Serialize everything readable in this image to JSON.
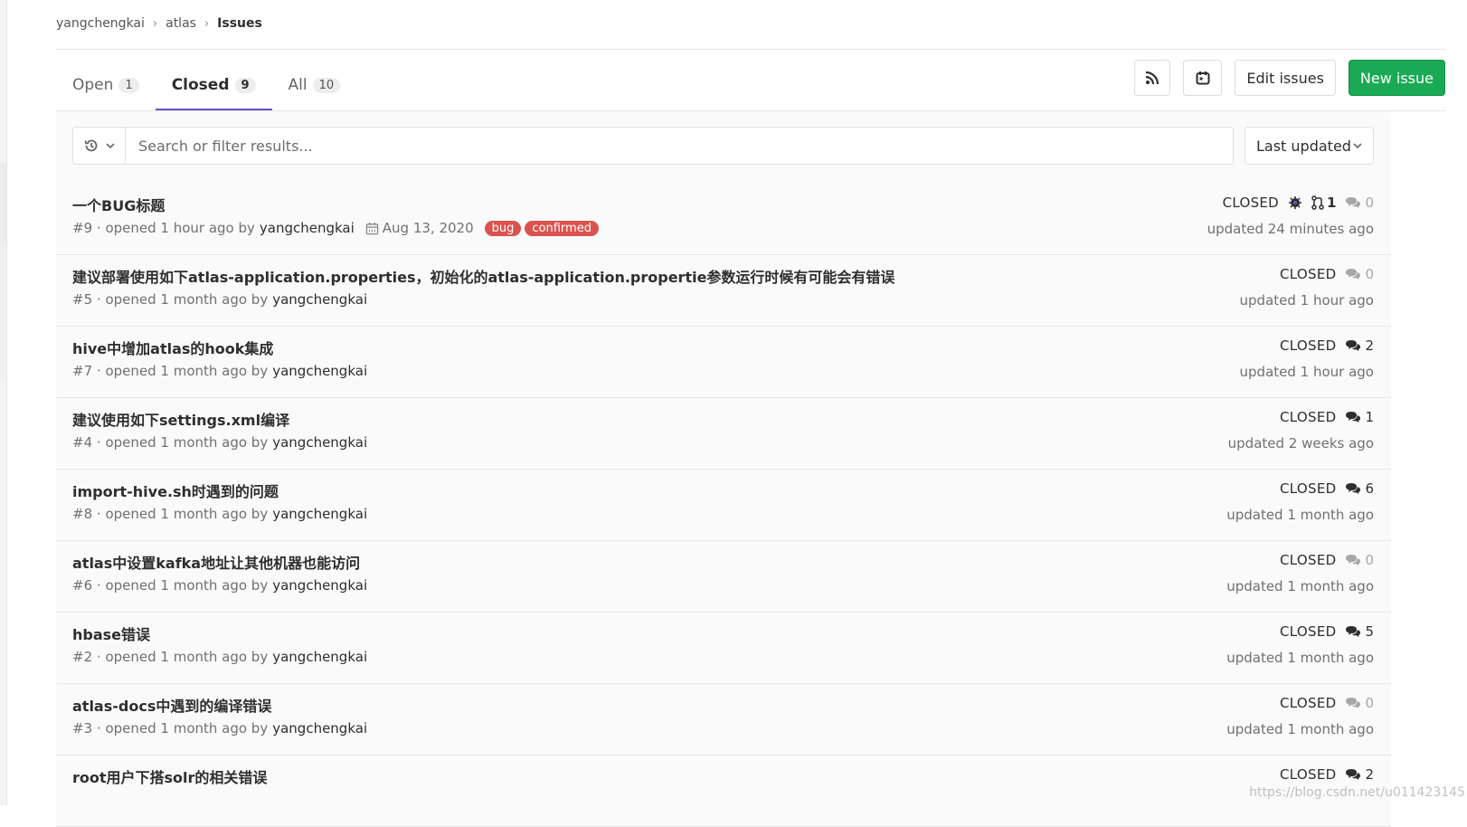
{
  "breadcrumb": {
    "items": [
      "yangchengkai",
      "atlas"
    ],
    "current": "Issues"
  },
  "tabs": [
    {
      "label": "Open",
      "count": "1",
      "active": false
    },
    {
      "label": "Closed",
      "count": "9",
      "active": true
    },
    {
      "label": "All",
      "count": "10",
      "active": false
    }
  ],
  "actions": {
    "rss_icon": "rss-icon",
    "calendar_icon": "calendar-icon",
    "edit_label": "Edit issues",
    "new_label": "New issue"
  },
  "filter": {
    "placeholder": "Search or filter results...",
    "sort_label": "Last updated"
  },
  "colors": {
    "accent": "#6b4fbb",
    "primary": "#1aaa55",
    "label_bg": "#d9534f"
  },
  "issues": [
    {
      "title": "一个BUG标题",
      "number": "#9",
      "opened": "opened 1 hour ago by",
      "author": "yangchengkai",
      "due": "Aug 13, 2020",
      "labels": [
        "bug",
        "confirmed"
      ],
      "state": "CLOSED",
      "milestone": true,
      "mr_count": "1",
      "notes": "0",
      "updated": "updated 24 minutes ago"
    },
    {
      "title": "建议部署使用如下atlas-application.properties，初始化的atlas-application.propertie参数运行时候有可能会有错误",
      "number": "#5",
      "opened": "opened 1 month ago by",
      "author": "yangchengkai",
      "state": "CLOSED",
      "notes": "0",
      "updated": "updated 1 hour ago"
    },
    {
      "title": "hive中增加atlas的hook集成",
      "number": "#7",
      "opened": "opened 1 month ago by",
      "author": "yangchengkai",
      "state": "CLOSED",
      "notes": "2",
      "updated": "updated 1 hour ago"
    },
    {
      "title": "建议使用如下settings.xml编译",
      "number": "#4",
      "opened": "opened 1 month ago by",
      "author": "yangchengkai",
      "state": "CLOSED",
      "notes": "1",
      "updated": "updated 2 weeks ago"
    },
    {
      "title": "import-hive.sh时遇到的问题",
      "number": "#8",
      "opened": "opened 1 month ago by",
      "author": "yangchengkai",
      "state": "CLOSED",
      "notes": "6",
      "updated": "updated 1 month ago"
    },
    {
      "title": "atlas中设置kafka地址让其他机器也能访问",
      "number": "#6",
      "opened": "opened 1 month ago by",
      "author": "yangchengkai",
      "state": "CLOSED",
      "notes": "0",
      "updated": "updated 1 month ago"
    },
    {
      "title": "hbase错误",
      "number": "#2",
      "opened": "opened 1 month ago by",
      "author": "yangchengkai",
      "state": "CLOSED",
      "notes": "5",
      "updated": "updated 1 month ago"
    },
    {
      "title": "atlas-docs中遇到的编译错误",
      "number": "#3",
      "opened": "opened 1 month ago by",
      "author": "yangchengkai",
      "state": "CLOSED",
      "notes": "0",
      "updated": "updated 1 month ago"
    },
    {
      "title": "root用户下搭solr的相关错误",
      "number": "",
      "opened": "",
      "author": "",
      "state": "CLOSED",
      "notes": "2",
      "updated": ""
    }
  ],
  "watermark": "https://blog.csdn.net/u011423145"
}
